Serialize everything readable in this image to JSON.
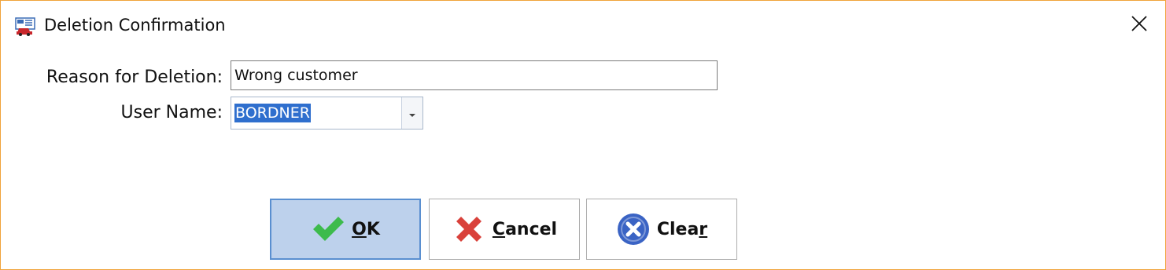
{
  "window": {
    "title": "Deletion Confirmation",
    "app_icon": "car-form-icon",
    "close_icon": "close-icon",
    "border_color": "#f0a33a"
  },
  "form": {
    "reason_label": "Reason for Deletion:",
    "reason_value": "Wrong customer",
    "user_label": "User Name:",
    "user_value": "BORDNER",
    "user_selection_color": "#2f6fce"
  },
  "buttons": {
    "ok": {
      "mnemonic": "O",
      "rest": "K",
      "icon": "checkmark-icon",
      "color": "#3dbb4c"
    },
    "cancel": {
      "mnemonic": "C",
      "rest": "ancel",
      "icon": "x-mark-icon",
      "color": "#d9413b"
    },
    "clear": {
      "prefix": "Clea",
      "mnemonic": "r",
      "icon": "circle-x-icon",
      "color": "#3a63c4"
    }
  }
}
